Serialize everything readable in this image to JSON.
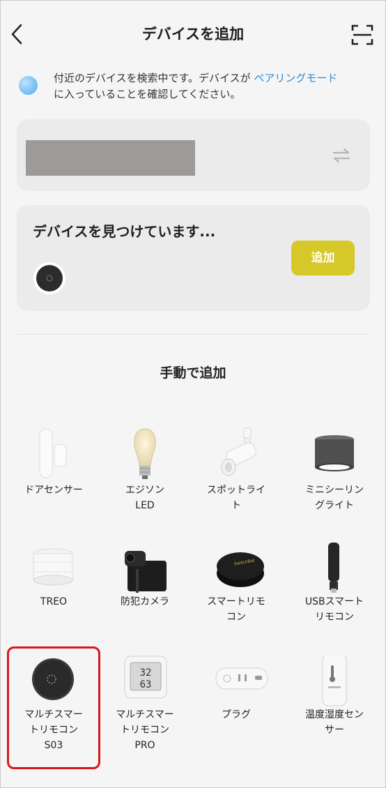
{
  "header": {
    "title": "デバイスを追加",
    "back_icon": "back-arrow-icon",
    "scan_icon": "scan-icon"
  },
  "notice": {
    "text_before": "付近のデバイスを検索中です。デバイスが ",
    "link": "ペアリングモード",
    "text_after": "に入っていることを確認してください。"
  },
  "found": {
    "title": "デバイスを見つけています...",
    "add_label": "追加"
  },
  "manual": {
    "title": "手動で追加",
    "items": [
      {
        "label": "ドアセンサー",
        "icon": "door-sensor-icon"
      },
      {
        "label": "エジソン\nLED",
        "icon": "edison-bulb-icon"
      },
      {
        "label": "スポットライ\nト",
        "icon": "spotlight-icon"
      },
      {
        "label": "ミニシーリン\nグライト",
        "icon": "ceiling-light-icon"
      },
      {
        "label": "TREO",
        "icon": "treo-light-icon"
      },
      {
        "label": "防犯カメラ",
        "icon": "security-camera-icon"
      },
      {
        "label": "スマートリモ\nコン",
        "icon": "smart-remote-icon"
      },
      {
        "label": "USBスマート\nリモコン",
        "icon": "usb-remote-icon"
      },
      {
        "label": "マルチスマー\nトリモコン\nS03",
        "icon": "multi-remote-s03-icon"
      },
      {
        "label": "マルチスマー\nトリモコン\nPRO",
        "icon": "multi-remote-pro-icon"
      },
      {
        "label": "プラグ",
        "icon": "plug-icon"
      },
      {
        "label": "温度湿度セン\nサー",
        "icon": "thermo-hygrometer-icon"
      }
    ]
  },
  "colors": {
    "accent_yellow": "#d6c829",
    "link_blue": "#2c8ad6",
    "highlight_red": "#d9171b"
  }
}
